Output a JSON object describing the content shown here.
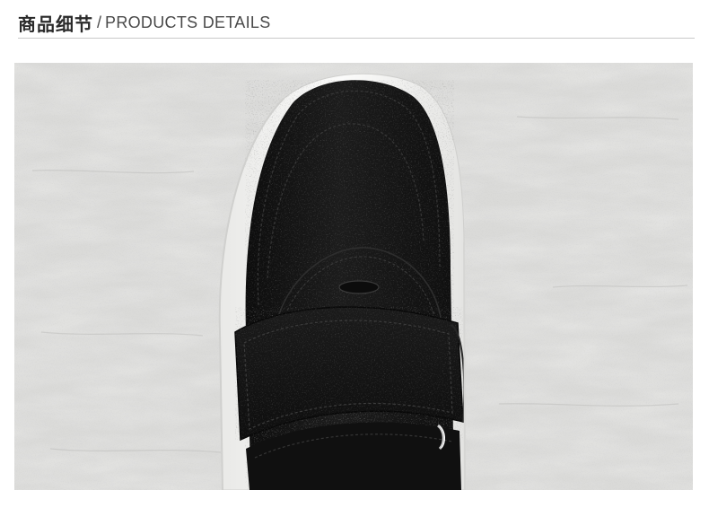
{
  "header": {
    "title_cn": "商品细节",
    "separator": "/",
    "title_en": "PRODUCTS DETAILS"
  },
  "photo": {
    "subject": "black-suede-velcro-sneaker-toe",
    "colors": {
      "background_concrete": "#d7d7d5",
      "shoe_upper": "#141414",
      "sole": "#f4f4f2"
    }
  }
}
